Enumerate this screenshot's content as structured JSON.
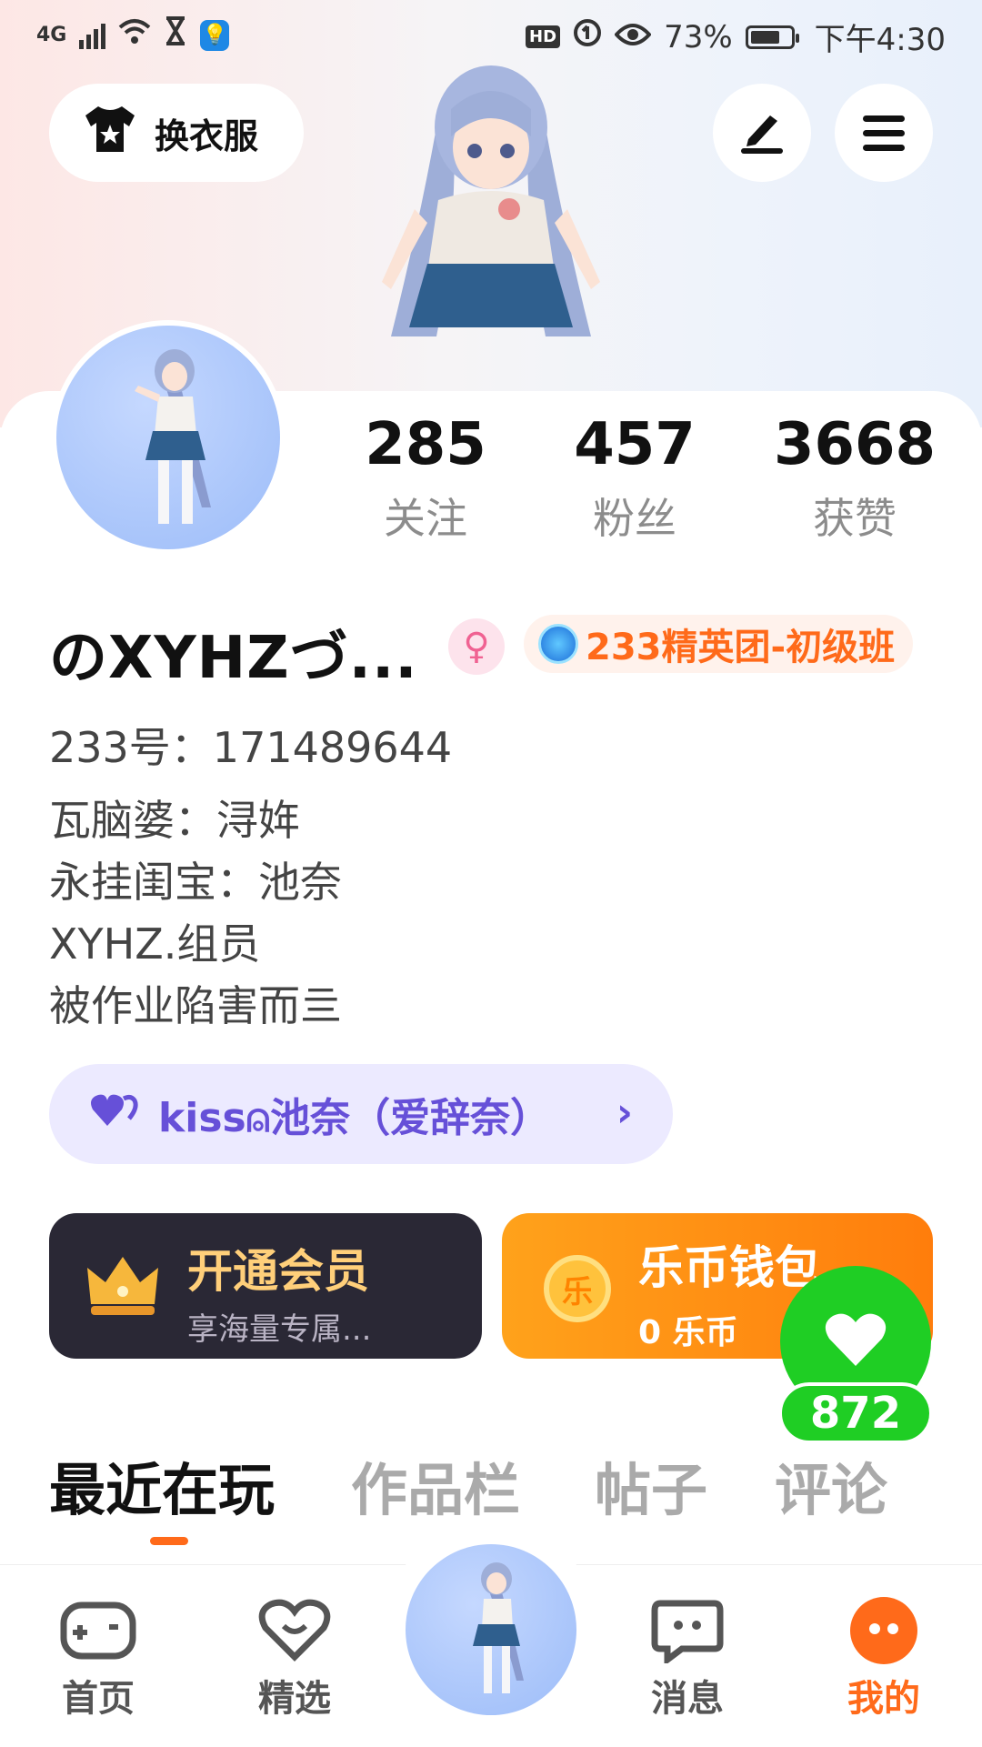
{
  "status_bar": {
    "signal": "4G",
    "battery_pct": "73%",
    "battery_level": 0.73,
    "time": "下午4:30",
    "hd": "HD"
  },
  "header": {
    "outfit_label": "换衣服",
    "edit_icon": "edit-icon",
    "menu_icon": "menu-icon"
  },
  "profile": {
    "stats": [
      {
        "value": "285",
        "label": "关注"
      },
      {
        "value": "457",
        "label": "粉丝"
      },
      {
        "value": "3668",
        "label": "获赞"
      }
    ],
    "username": "のXYHZづ...",
    "gender_symbol": "♀",
    "badge": "233精英团-初级班",
    "uid": "233号：171489644",
    "bio": [
      "瓦脑婆：浔姩",
      "永挂闺宝：池奈",
      "XYHZ.组员",
      "被作业陷害而亖"
    ],
    "relation": "kiss⍝池奈（爱辞奈）"
  },
  "cards": {
    "vip_title": "开通会员",
    "vip_subtitle": "享海量专属...",
    "wallet_title": "乐币钱包",
    "wallet_coin": "乐",
    "wallet_balance": "0 乐币"
  },
  "likes": "872",
  "tabs": [
    "最近在玩",
    "作品栏",
    "帖子",
    "评论"
  ],
  "nav": [
    "首页",
    "精选",
    "消息",
    "我的"
  ],
  "colors": {
    "accent": "#ff6a1a",
    "like": "#1fce24",
    "purple": "#6650d8"
  }
}
